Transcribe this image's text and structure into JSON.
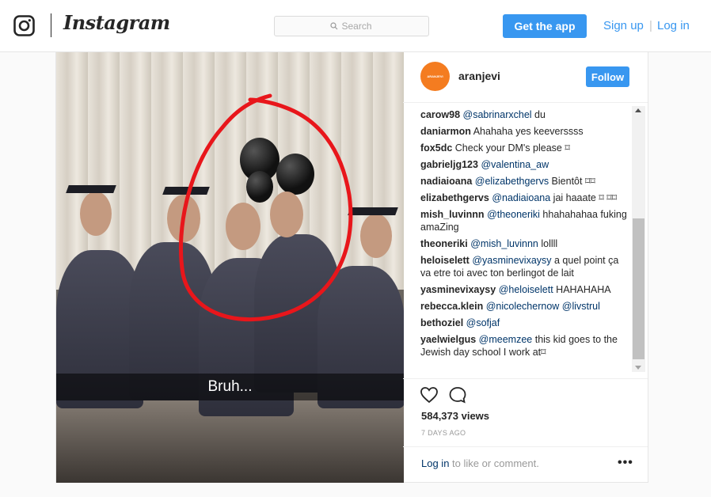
{
  "nav": {
    "wordmark": "Instagram",
    "search_placeholder": "Search",
    "get_app": "Get the app",
    "sign_up": "Sign up",
    "separator": "|",
    "log_in": "Log in"
  },
  "post": {
    "author": "aranjevi",
    "avatar_text": "ARANJEVI",
    "follow": "Follow",
    "media_caption": "Bruh...",
    "comments": [
      {
        "user": "carow98",
        "mention": "@sabrinarxchel",
        "text": " du"
      },
      {
        "user": "daniarmon",
        "mention": "",
        "text": "Ahahaha yes keeverssss"
      },
      {
        "user": "fox5dc",
        "mention": "",
        "text": "Check your DM's please ⌑"
      },
      {
        "user": "gabrieljg123",
        "mention": "@valentina_aw",
        "text": ""
      },
      {
        "user": "nadiaioana",
        "mention": "@elizabethgervs",
        "text": " Bientôt ⌑⌑"
      },
      {
        "user": "elizabethgervs",
        "mention": "@nadiaioana",
        "text": " jai haaate ⌑ ⌑⌑"
      },
      {
        "user": "mish_luvinnn",
        "mention": "@theoneriki",
        "text": " hhahahahaa fuking amaZing"
      },
      {
        "user": "theoneriki",
        "mention": "@mish_luvinnn",
        "text": " lollll"
      },
      {
        "user": "heloiselett",
        "mention": "@yasminevixaysy",
        "text": " a quel point ça va etre toi avec ton berlingot de lait"
      },
      {
        "user": "yasminevixaysy",
        "mention": "@heloiselett",
        "text": " HAHAHAHA"
      },
      {
        "user": "rebecca.klein",
        "mention": "@nicolechernow @livstrul",
        "text": ""
      },
      {
        "user": "bethoziel",
        "mention": "@sofjaf",
        "text": ""
      },
      {
        "user": "yaelwielgus",
        "mention": "@meemzee",
        "text": " this kid goes to the Jewish day school I work at⌑"
      }
    ],
    "views": "584,373 views",
    "time_ago": "7 DAYS AGO",
    "login_link": "Log in",
    "login_rest": " to like or comment.",
    "more": "•••"
  },
  "colors": {
    "accent": "#3897f0",
    "avatar": "#f47c20",
    "annotation": "#e8161b"
  },
  "icons": [
    "instagram-glyph-icon",
    "search-icon",
    "heart-icon",
    "comment-icon",
    "more-options-icon",
    "scroll-up-arrow-icon",
    "scroll-down-arrow-icon"
  ]
}
